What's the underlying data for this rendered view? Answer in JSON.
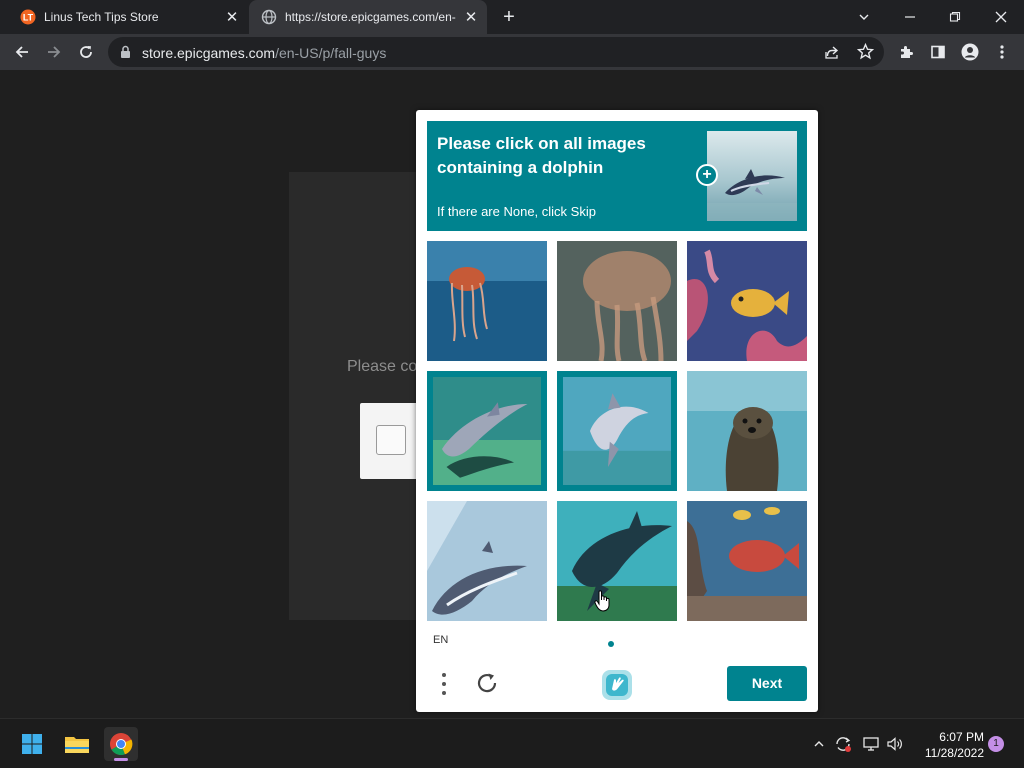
{
  "browser": {
    "tabs": [
      {
        "title": "Linus Tech Tips Store",
        "active": false,
        "favicon": "ltt-logo-icon"
      },
      {
        "title": "https://store.epicgames.com/en-",
        "active": true,
        "favicon": "globe-icon"
      }
    ],
    "url": {
      "host": "store.epicgames.com",
      "path": "/en-US/p/fall-guys"
    }
  },
  "page": {
    "background_text": "Please co"
  },
  "captcha": {
    "prompt_lines": [
      "Please click on all images",
      "containing a dolphin"
    ],
    "prompt_sub": "If there are None, click Skip",
    "tiles": [
      {
        "label": "jellyfish",
        "selected": false
      },
      {
        "label": "jellyfish",
        "selected": false
      },
      {
        "label": "reef fish",
        "selected": false
      },
      {
        "label": "dolphin",
        "selected": true
      },
      {
        "label": "dolphin",
        "selected": true
      },
      {
        "label": "otter",
        "selected": false
      },
      {
        "label": "dolphin",
        "selected": false
      },
      {
        "label": "dolphin",
        "selected": false
      },
      {
        "label": "reef fish",
        "selected": false
      }
    ],
    "language": "EN",
    "next_label": "Next",
    "accent_color": "#00838f"
  },
  "taskbar": {
    "time": "6:07 PM",
    "date": "11/28/2022",
    "notification_count": "1"
  }
}
